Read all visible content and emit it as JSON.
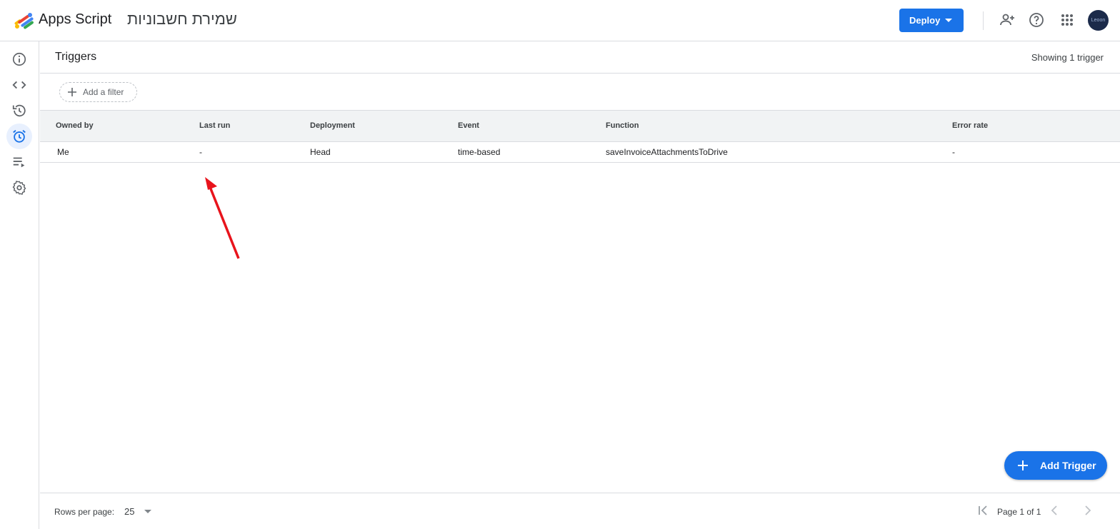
{
  "header": {
    "app_name": "Apps Script",
    "project_name": "שמירת חשבוניות",
    "deploy_label": "Deploy",
    "avatar_text": "Leoon",
    "icons": [
      "apps-script-logo",
      "add-person-icon",
      "help-icon",
      "apps-grid-icon",
      "avatar"
    ]
  },
  "rail": {
    "items": [
      {
        "name": "overview",
        "icon": "info-icon"
      },
      {
        "name": "editor",
        "icon": "code-icon"
      },
      {
        "name": "project-history",
        "icon": "history-icon"
      },
      {
        "name": "triggers",
        "icon": "alarm-icon",
        "active": true
      },
      {
        "name": "executions",
        "icon": "executions-icon"
      },
      {
        "name": "project-settings",
        "icon": "gear-icon"
      }
    ]
  },
  "page": {
    "title": "Triggers",
    "showing": "Showing 1 trigger",
    "filter_label": "Add a filter"
  },
  "table": {
    "columns": [
      "Owned by",
      "Last run",
      "Deployment",
      "Event",
      "Function",
      "Error rate"
    ],
    "rows": [
      [
        "Me",
        "-",
        "Head",
        "time-based",
        "saveInvoiceAttachmentsToDrive",
        "-"
      ]
    ]
  },
  "fab": {
    "label": "Add Trigger"
  },
  "footer": {
    "rows_per_page_label": "Rows per page:",
    "rows_per_page_value": "25",
    "page_info": "Page 1 of 1"
  },
  "colors": {
    "primary": "#1a73e8",
    "active_rail_bg": "#e8f0fe",
    "annotation_arrow": "#e8141c"
  }
}
